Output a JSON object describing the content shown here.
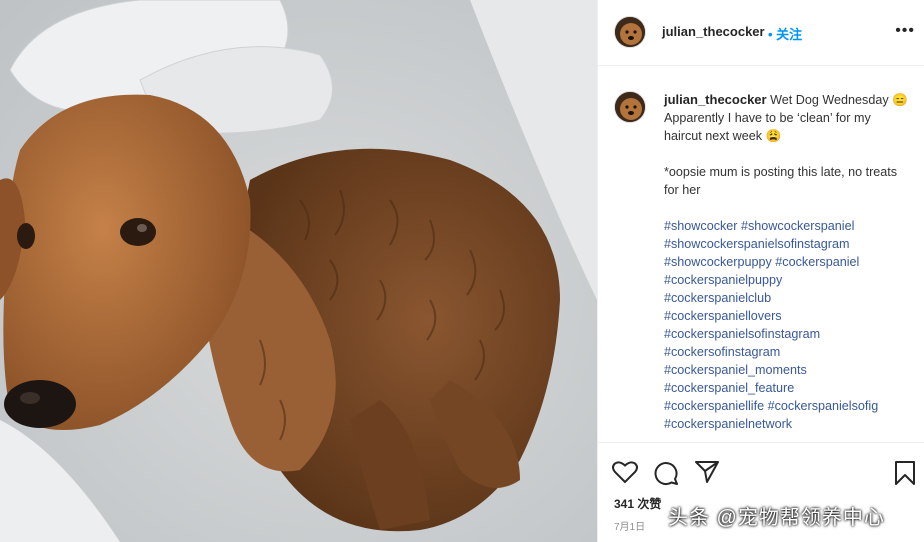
{
  "post": {
    "username": "julian_thecocker",
    "follow_label": "• 关注",
    "more_label": "•••",
    "caption": {
      "username": "julian_thecocker",
      "line1": "Wet Dog Wednesday",
      "emoji1": "😑",
      "line2": "Apparently I have to be ‘clean’ for my haircut next week",
      "emoji2": "😩",
      "line3": "*oopsie mum is posting this late, no treats for her",
      "hashtags": [
        "#showcocker #showcockerspaniel",
        "#showcockerspanielsofinstagram",
        "#showcockerpuppy #cockerspaniel",
        "#cockerspanielpuppy",
        "#cockerspanielclub",
        "#cockerspaniellovers",
        "#cockerspanielsofinstagram",
        "#cockersofinstagram",
        "#cockerspaniel_moments",
        "#cockerspaniel_feature",
        "#cockerspaniellife #cockerspanielsofig",
        "#cockerspanielnetwork"
      ]
    },
    "likes": "341 次赞",
    "date": "7月1日",
    "icons": [
      "heart-icon",
      "comment-icon",
      "share-icon",
      "bookmark-icon"
    ]
  },
  "watermark": "头条 @宠物帮领养中心",
  "colors": {
    "accent": "#0095f6",
    "hashtag": "#385898"
  }
}
